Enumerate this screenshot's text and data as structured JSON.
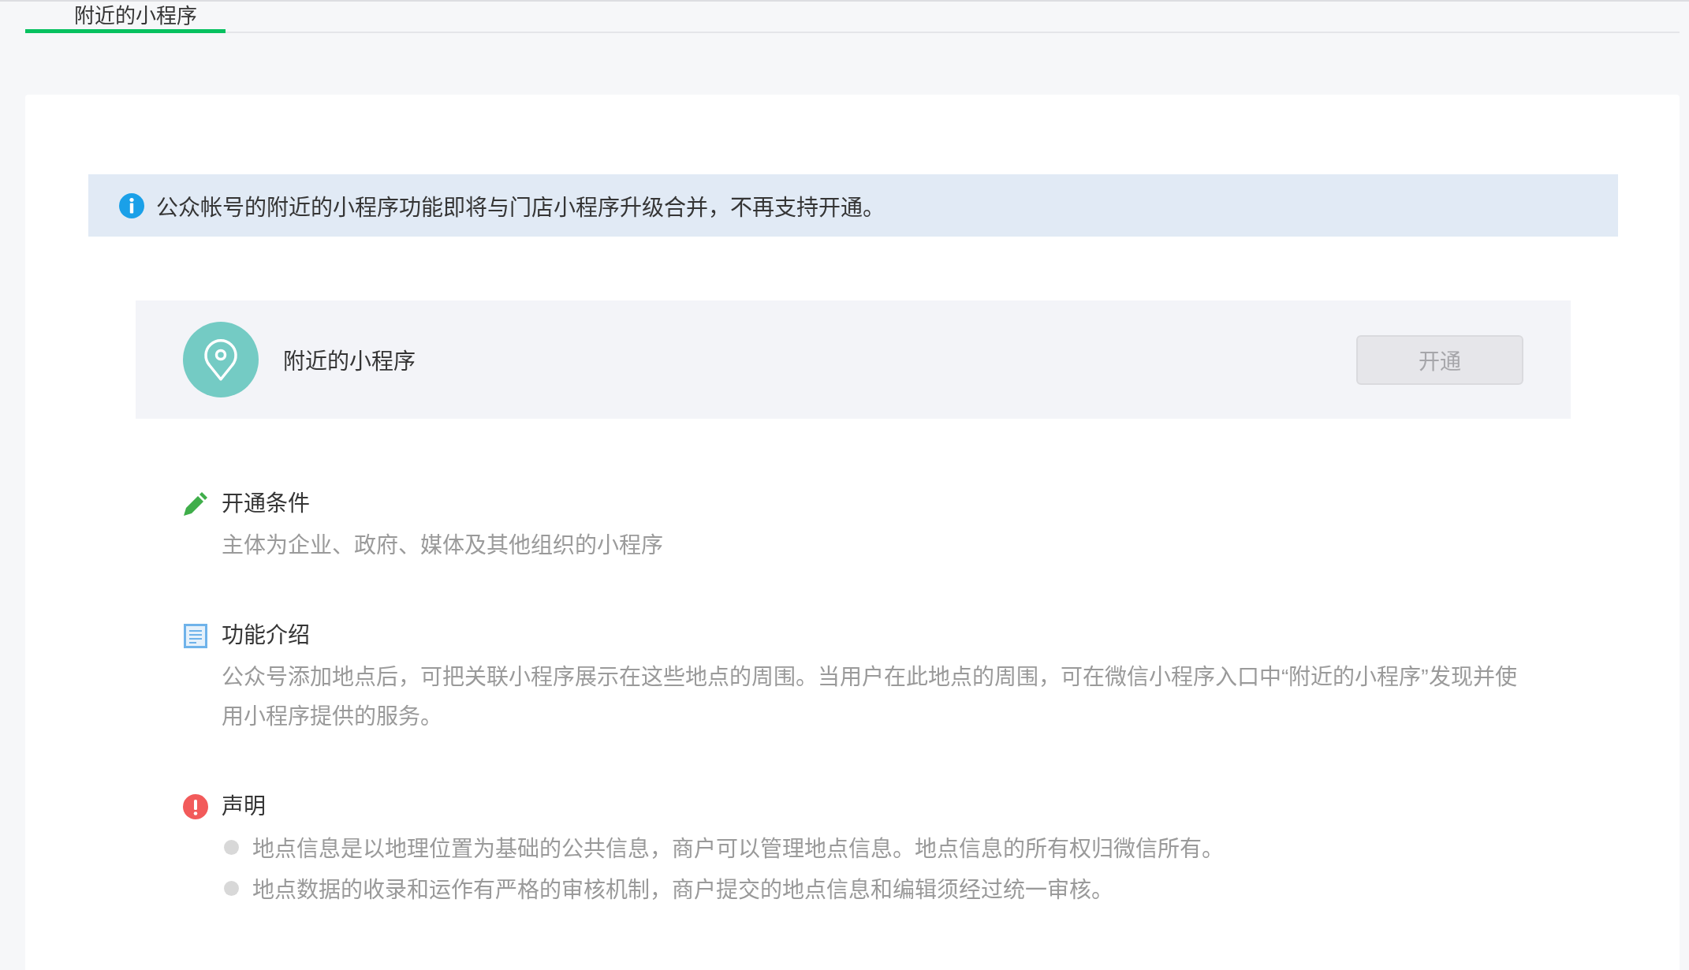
{
  "tabs": [
    {
      "label": "附近的小程序",
      "selected": true
    }
  ],
  "notice": {
    "text": "公众帐号的附近的小程序功能即将与门店小程序升级合并，不再支持开通。"
  },
  "feature": {
    "title": "附近的小程序",
    "button": {
      "label": "开通",
      "disabled": true
    }
  },
  "sections": [
    {
      "kind": "conditions",
      "title": "开通条件",
      "text": "主体为企业、政府、媒体及其他组织的小程序"
    },
    {
      "kind": "introduction",
      "title": "功能介绍",
      "text": "公众号添加地点后，可把关联小程序展示在这些地点的周围。当用户在此地点的周围，可在微信小程序入口中“附近的小程序”发现并使用小程序提供的服务。"
    },
    {
      "kind": "statement",
      "title": "声明",
      "items": [
        "地点信息是以地理位置为基础的公共信息，商户可以管理地点信息。地点信息的所有权归微信所有。",
        "地点数据的收录和运作有严格的审核机制，商户提交的地点信息和编辑须经过统一审核。"
      ]
    }
  ]
}
